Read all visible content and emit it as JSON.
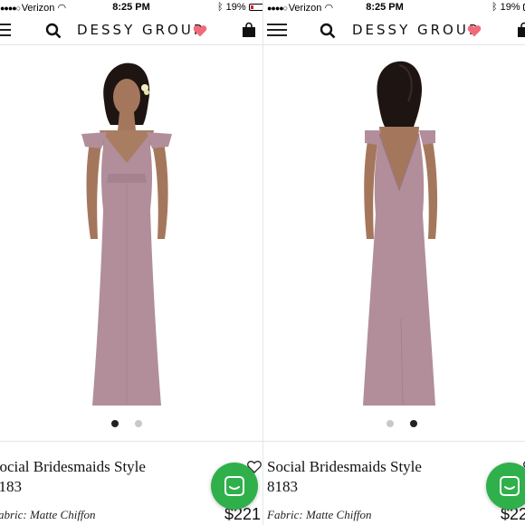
{
  "status": {
    "carrier": "Verizon",
    "time": "8:25 PM",
    "battery": "19%"
  },
  "nav": {
    "brand": "DESSY GROUP"
  },
  "product": {
    "title": "Social Bridesmaids Style",
    "style_number": "8183",
    "fabric": "Fabric: Matte Chiffon",
    "price": "$221"
  },
  "carousel": {
    "left_panel_active_index": 0,
    "right_panel_active_index": 1,
    "total": 2
  },
  "colors": {
    "dress": "#b18e9a",
    "dress_shadow": "#9a7683",
    "accent_heart": "#f26a7a",
    "chat": "#2fb04a",
    "active_dot": "#222222",
    "inactive_dot": "#c8c8c8"
  },
  "icons": [
    "hamburger-icon",
    "search-icon",
    "heart-icon",
    "shopping-bag-icon",
    "wishlist-heart-icon",
    "chat-icon",
    "wifi-icon",
    "bluetooth-icon",
    "battery-icon"
  ]
}
